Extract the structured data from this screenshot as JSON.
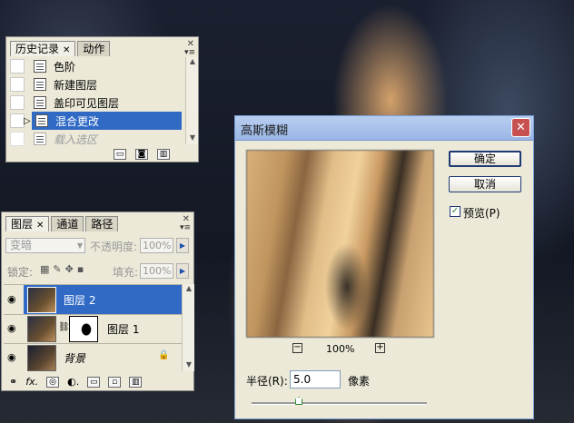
{
  "history_panel": {
    "tabs": [
      "历史记录",
      "动作"
    ],
    "items": [
      "色阶",
      "新建图层",
      "盖印可见图层",
      "混合更改",
      "载入选区"
    ],
    "selected_index": 3
  },
  "layers_panel": {
    "tabs": [
      "图层",
      "通道",
      "路径"
    ],
    "blend_mode": "变暗",
    "opacity_label": "不透明度:",
    "opacity_value": "100%",
    "lock_label": "锁定:",
    "fill_label": "填充:",
    "fill_value": "100%",
    "layers": [
      "图层 2",
      "图层 1",
      "背景"
    ],
    "selected_layer": 0
  },
  "dialog": {
    "title": "高斯模糊",
    "ok_label": "确定",
    "cancel_label": "取消",
    "preview_label": "预览(P)",
    "preview_checked": true,
    "zoom": "100%",
    "radius_label": "半径(R):",
    "radius_value": "5.0",
    "unit": "像素",
    "slider_fraction": 0.27
  },
  "colors": {
    "selection": "#316ac5",
    "panel_bg": "#ece9d8",
    "titlebar": "#9ab6e6",
    "close_button": "#c75050"
  }
}
